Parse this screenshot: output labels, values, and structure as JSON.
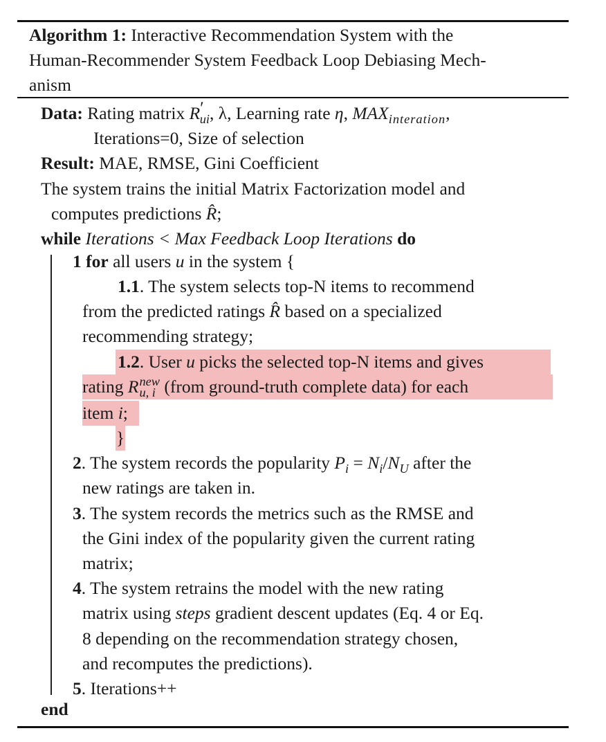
{
  "caption": {
    "label": "Algorithm 1:",
    "line1": "Interactive Recommendation System with the",
    "line2": "Human-Recommender System Feedback Loop Debiasing Mech-",
    "line3": "anism"
  },
  "data_line": {
    "label": "Data:",
    "text_a": "Rating matrix",
    "matrix_symbol": "R",
    "matrix_prime": "′",
    "matrix_sub": "ui",
    "text_b": ", λ, Learning rate",
    "eta": "η",
    "text_c": ",",
    "max_main": "MAX",
    "max_sub": "interation",
    "text_d": ",",
    "line2": "Iterations=0, Size of selection"
  },
  "result_line": {
    "label": "Result:",
    "text": "MAE, RMSE, Gini Coefficient"
  },
  "intro": {
    "line1": "The system trains the initial Matrix Factorization model and",
    "line2_a": "computes predictions",
    "rhat": "R̂",
    "line2_b": ";"
  },
  "while_line": {
    "kw_while": "while",
    "condition": "Iterations < Max Feedback Loop Iterations",
    "kw_do": "do"
  },
  "step1": {
    "num": "1",
    "kw_for": "for",
    "text_a": "all users",
    "u": "u",
    "text_b": "in the system {"
  },
  "step1_1": {
    "num": "1.1",
    "line1": ". The system selects top-N items to recommend",
    "line2_a": "from the predicted ratings",
    "rhat": "R̂",
    "line2_b": "based on a specialized",
    "line3": "recommending strategy;"
  },
  "step1_2": {
    "num": "1.2",
    "line1_a": ". User",
    "u": "u",
    "line1_b": "picks the selected top-N items and gives",
    "line2_a": "rating",
    "r_symbol": "R",
    "r_sup": "new",
    "r_sub": "u, i",
    "line2_b": "(from ground-truth complete data) for each",
    "line3_a": "item",
    "i": "i",
    "line3_b": ";",
    "close_brace": "}"
  },
  "step2": {
    "num": "2",
    "line1_a": ". The system records the popularity",
    "formula": "P",
    "formula_sub_i": "i",
    "formula_eq": " = ",
    "formula_n": "N",
    "formula_slash": "/",
    "formula_nu": "N",
    "formula_sub_u": "U",
    "line1_b": "after the",
    "line2": "new ratings are taken in."
  },
  "step3": {
    "num": "3",
    "line1": ". The system records the metrics such as the RMSE and",
    "line2": "the Gini index of the popularity given the current rating",
    "line3": "matrix;"
  },
  "step4": {
    "num": "4",
    "line1": ". The system retrains the model with the new rating",
    "line2_a": "matrix using",
    "steps": "steps",
    "line2_b": "gradient descent updates (Eq. 4 or Eq.",
    "line3": "8 depending on the recommendation strategy chosen,",
    "line4": "and recomputes the predictions)."
  },
  "step5": {
    "num": "5",
    "text": ". Iterations++"
  },
  "end_kw": "end",
  "colors": {
    "highlight": "#f4bcbc",
    "text": "#1a1a1a"
  }
}
